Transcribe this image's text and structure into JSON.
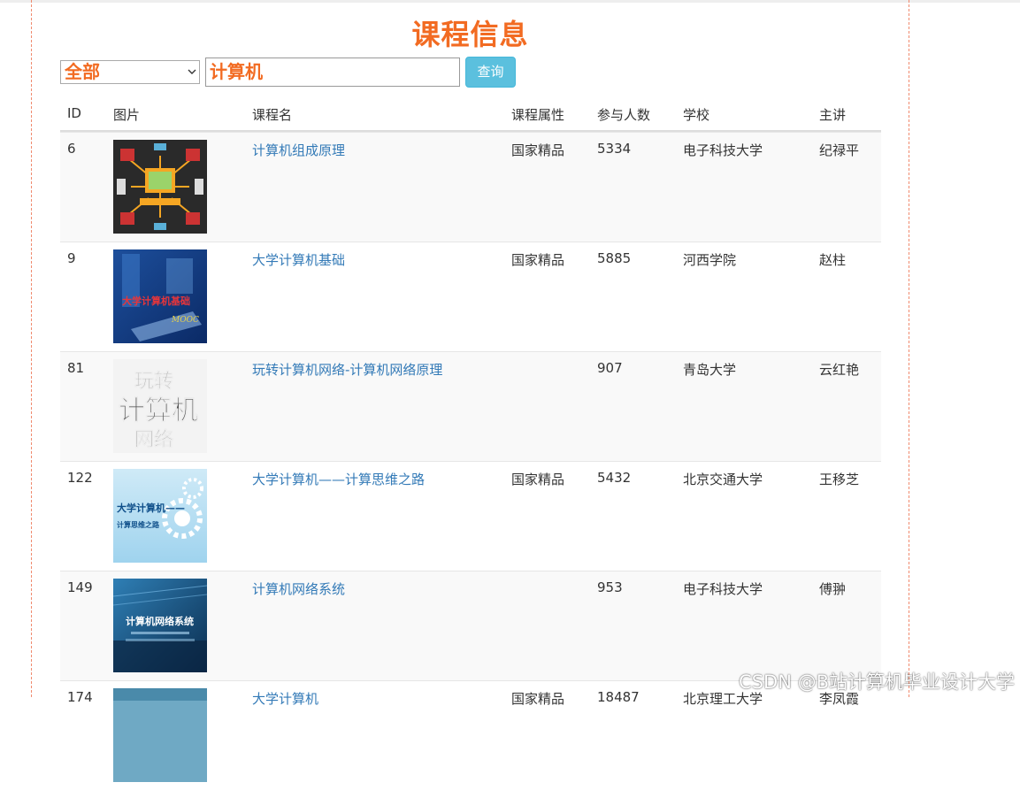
{
  "title": "课程信息",
  "search": {
    "category_value": "全部",
    "keyword_value": "计算机",
    "query_label": "查询"
  },
  "table": {
    "headers": [
      "ID",
      "图片",
      "课程名",
      "课程属性",
      "参与人数",
      "学校",
      "主讲"
    ],
    "rows": [
      {
        "id": "6",
        "image": "computer-network-diagram",
        "name": "计算机组成原理",
        "attr": "国家精品",
        "count": "5334",
        "school": "电子科技大学",
        "teacher": "纪禄平"
      },
      {
        "id": "9",
        "image": "blue-laptop-cover",
        "name": "大学计算机基础",
        "attr": "国家精品",
        "count": "5885",
        "school": "河西学院",
        "teacher": "赵柱"
      },
      {
        "id": "81",
        "image": "play-computer-network-text",
        "name": "玩转计算机网络-计算机网络原理",
        "attr": "",
        "count": "907",
        "school": "青岛大学",
        "teacher": "云红艳"
      },
      {
        "id": "122",
        "image": "light-blue-gears",
        "name": "大学计算机——计算思维之路",
        "attr": "国家精品",
        "count": "5432",
        "school": "北京交通大学",
        "teacher": "王移芝"
      },
      {
        "id": "149",
        "image": "dark-blue-network-system",
        "name": "计算机网络系统",
        "attr": "",
        "count": "953",
        "school": "电子科技大学",
        "teacher": "傅翀"
      },
      {
        "id": "174",
        "image": "teal-cover",
        "name": "大学计算机",
        "attr": "国家精品",
        "count": "18487",
        "school": "北京理工大学",
        "teacher": "李凤霞"
      }
    ]
  },
  "thumb_text": {
    "t2": "大学计算机基础",
    "t2b": "MOOC",
    "t3a": "玩转",
    "t3b": "计算机",
    "t3c": "网络",
    "t4a": "大学计算机——",
    "t4b": "计算思维之路",
    "t5": "计算机网络系统"
  },
  "watermark": "CSDN @B站计算机毕业设计大学",
  "colors": {
    "title": "#f26b22",
    "link": "#337ab7",
    "button": "#5bc0de",
    "border_dashed": "#f08a6e"
  }
}
